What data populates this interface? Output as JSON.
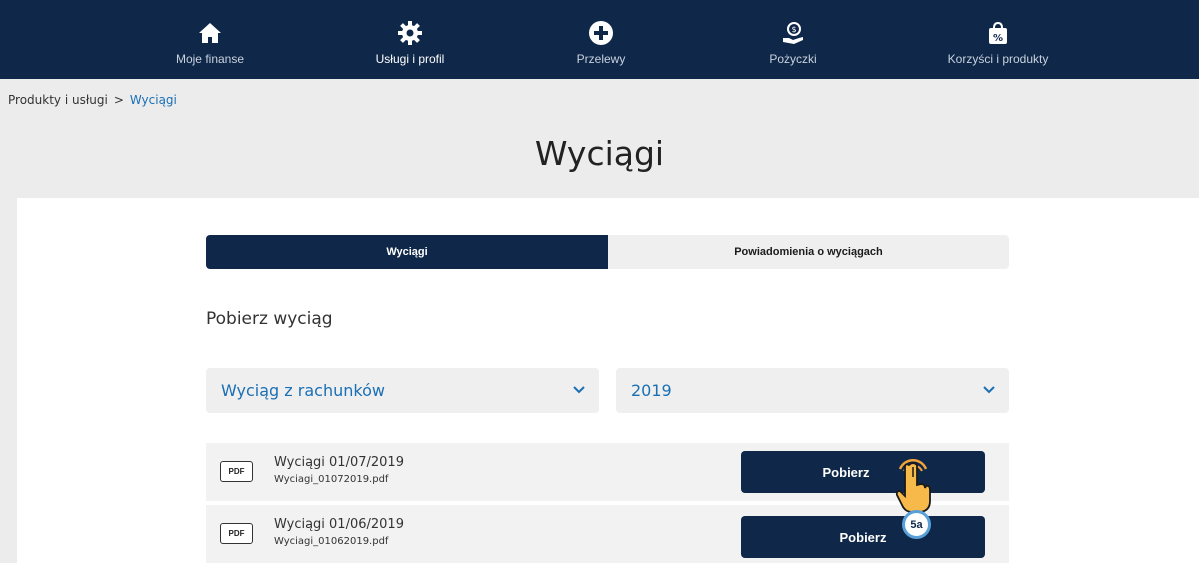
{
  "nav": {
    "items": [
      {
        "label": "Moje finanse",
        "icon": "home-icon"
      },
      {
        "label": "Usługi i profil",
        "icon": "gear-icon"
      },
      {
        "label": "Przelewy",
        "icon": "plus-circle-icon"
      },
      {
        "label": "Pożyczki",
        "icon": "money-hand-icon"
      },
      {
        "label": "Korzyści i produkty",
        "icon": "percent-bag-icon"
      }
    ],
    "active_index": 1
  },
  "breadcrumb": {
    "root": "Produkty i usługi",
    "separator": ">",
    "current": "Wyciągi"
  },
  "page": {
    "title": "Wyciągi"
  },
  "tabs": {
    "active": "Wyciągi",
    "inactive": "Powiadomienia o wyciągach"
  },
  "section": {
    "title": "Pobierz wyciąg"
  },
  "filters": {
    "type_value": "Wyciąg z rachunków",
    "year_value": "2019"
  },
  "statements": [
    {
      "title": "Wyciągi 01/07/2019",
      "file": "Wyciagi_01072019.pdf",
      "badge": "PDF",
      "button": "Pobierz"
    },
    {
      "title": "Wyciągi 01/06/2019",
      "file": "Wyciagi_01062019.pdf",
      "badge": "PDF",
      "button": "Pobierz"
    }
  ],
  "annotation": {
    "step": "5a"
  },
  "colors": {
    "navy": "#0f2748",
    "link_blue": "#1a6fb5",
    "background": "#ececec"
  }
}
